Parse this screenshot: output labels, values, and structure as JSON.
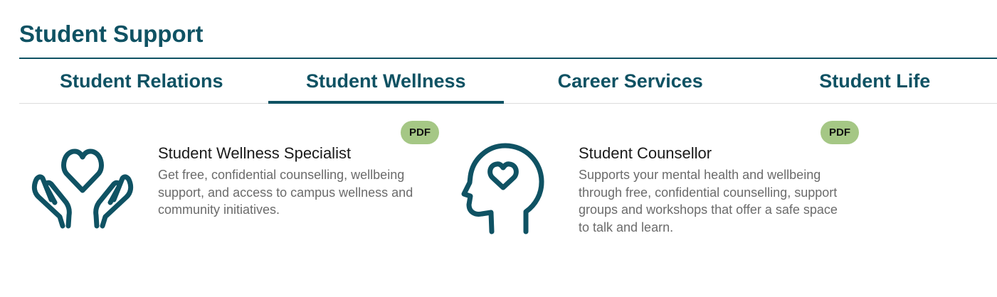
{
  "page": {
    "title": "Student Support"
  },
  "tabs": [
    {
      "label": "Student Relations",
      "active": false
    },
    {
      "label": "Student Wellness",
      "active": true
    },
    {
      "label": "Career Services",
      "active": false
    },
    {
      "label": "Student Life",
      "active": false
    }
  ],
  "cards": [
    {
      "icon": "hands-holding-heart-icon",
      "badge": "PDF",
      "title": "Student Wellness Specialist",
      "description": "Get free, confidential counselling, wellbeing support, and access to campus wellness and community initiatives."
    },
    {
      "icon": "head-with-heart-icon",
      "badge": "PDF",
      "title": "Student Counsellor",
      "description": "Supports your mental health and wellbeing through free, confidential counselling, support groups and workshops that offer a safe space to talk and learn."
    }
  ],
  "colors": {
    "brand": "#0f5263",
    "badge": "#a5c785",
    "description_text": "#6b6b6b"
  }
}
